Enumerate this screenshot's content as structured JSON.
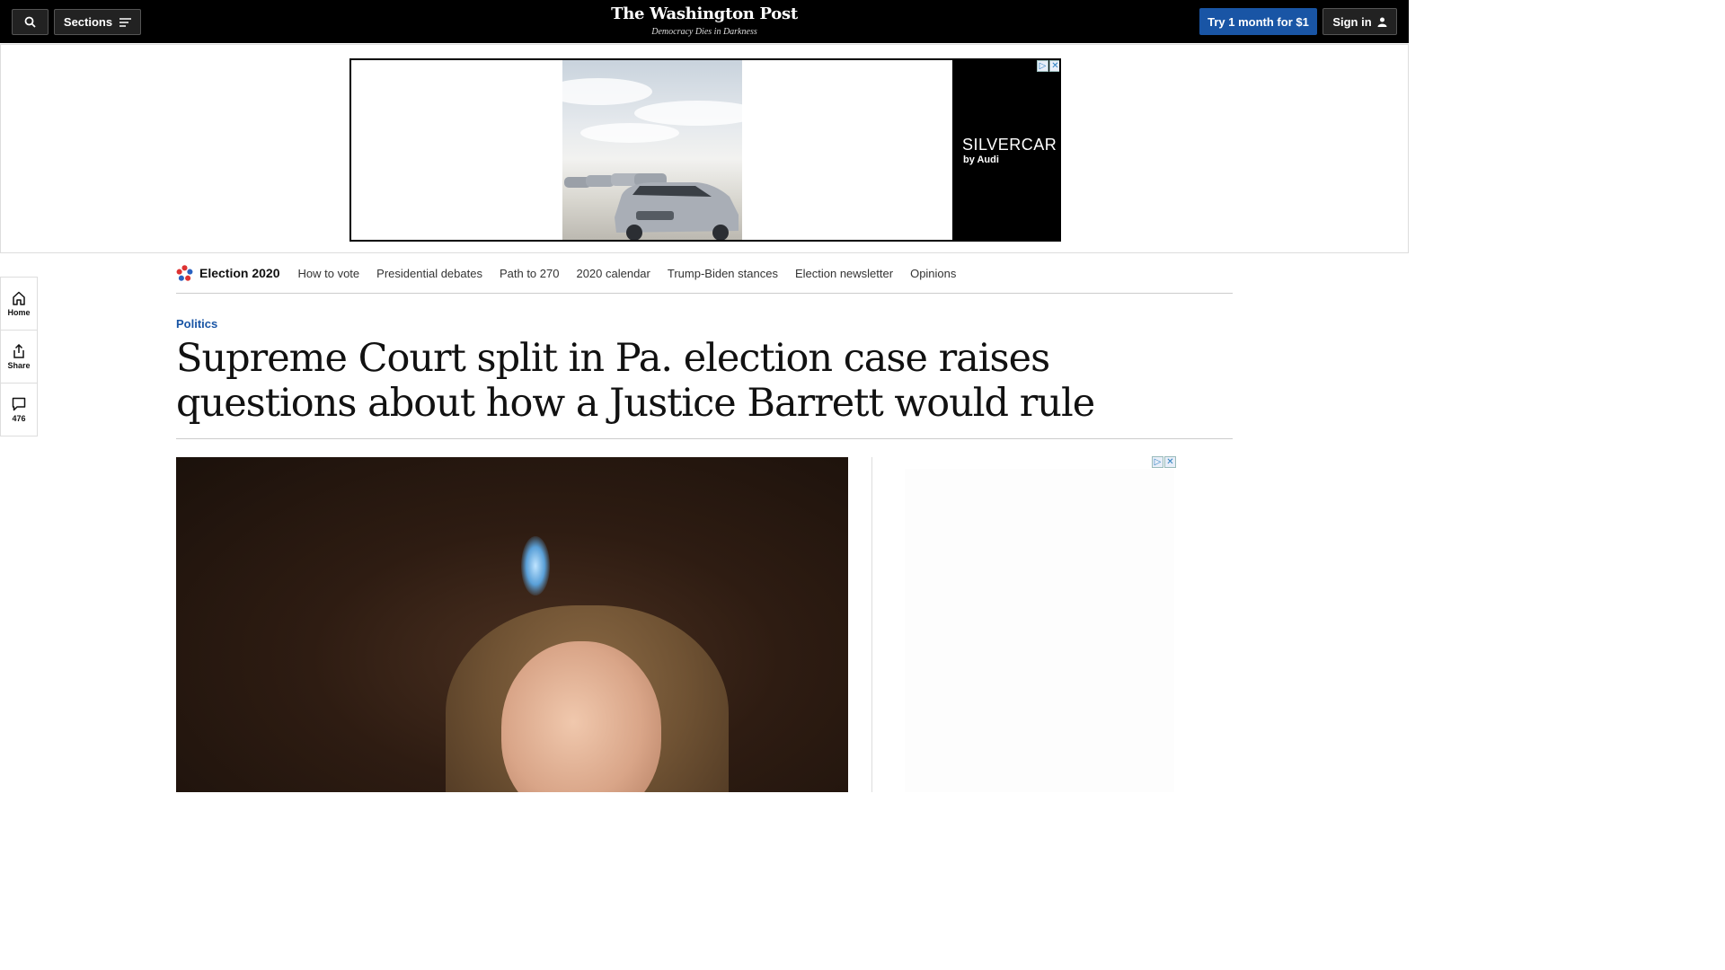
{
  "topbar": {
    "sections_label": "Sections",
    "logo": "The Washington Post",
    "tagline": "Democracy Dies in Darkness",
    "subscribe_label": "Try 1 month for $1",
    "signin_label": "Sign in"
  },
  "ad": {
    "brand": "SILVERCAR",
    "brand_sub": "by Audi"
  },
  "section_nav": {
    "title": "Election 2020",
    "links": [
      "How to vote",
      "Presidential debates",
      "Path to 270",
      "2020 calendar",
      "Trump-Biden stances",
      "Election newsletter",
      "Opinions"
    ]
  },
  "rail": {
    "home": "Home",
    "share": "Share",
    "comments": "476"
  },
  "article": {
    "kicker": "Politics",
    "headline": "Supreme Court split in Pa. election case raises questions about how a Justice Barrett would rule"
  },
  "colors": {
    "accent": "#1955a5",
    "topbar": "#000000"
  }
}
